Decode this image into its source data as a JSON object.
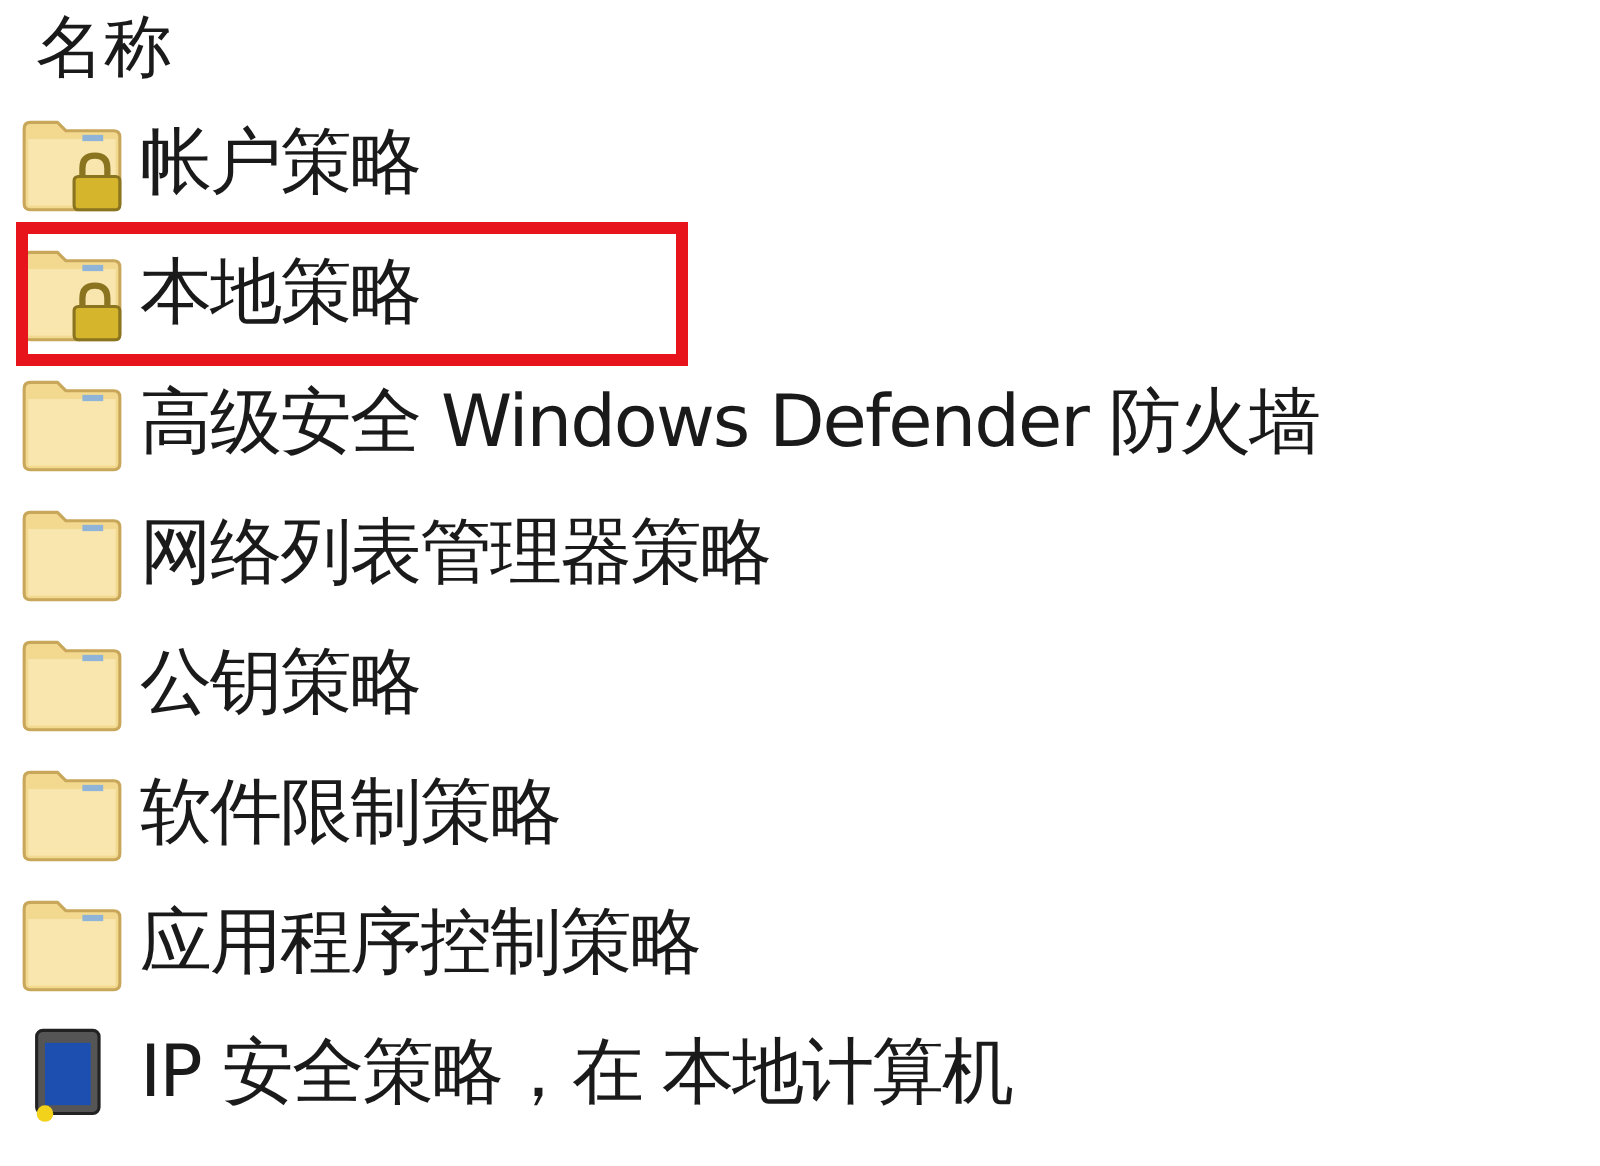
{
  "column_header": "名称",
  "items": [
    {
      "label": "帐户策略",
      "kind": "locked_folder",
      "highlighted": false
    },
    {
      "label": "本地策略",
      "kind": "locked_folder",
      "highlighted": true
    },
    {
      "label": "高级安全 Windows Defender 防火墙",
      "kind": "folder",
      "highlighted": false
    },
    {
      "label": "网络列表管理器策略",
      "kind": "folder",
      "highlighted": false
    },
    {
      "label": "公钥策略",
      "kind": "folder",
      "highlighted": false
    },
    {
      "label": "软件限制策略",
      "kind": "folder",
      "highlighted": false
    },
    {
      "label": "应用程序控制策略",
      "kind": "folder",
      "highlighted": false
    },
    {
      "label": "IP 安全策略，在 本地计算机",
      "kind": "security",
      "highlighted": false
    }
  ]
}
